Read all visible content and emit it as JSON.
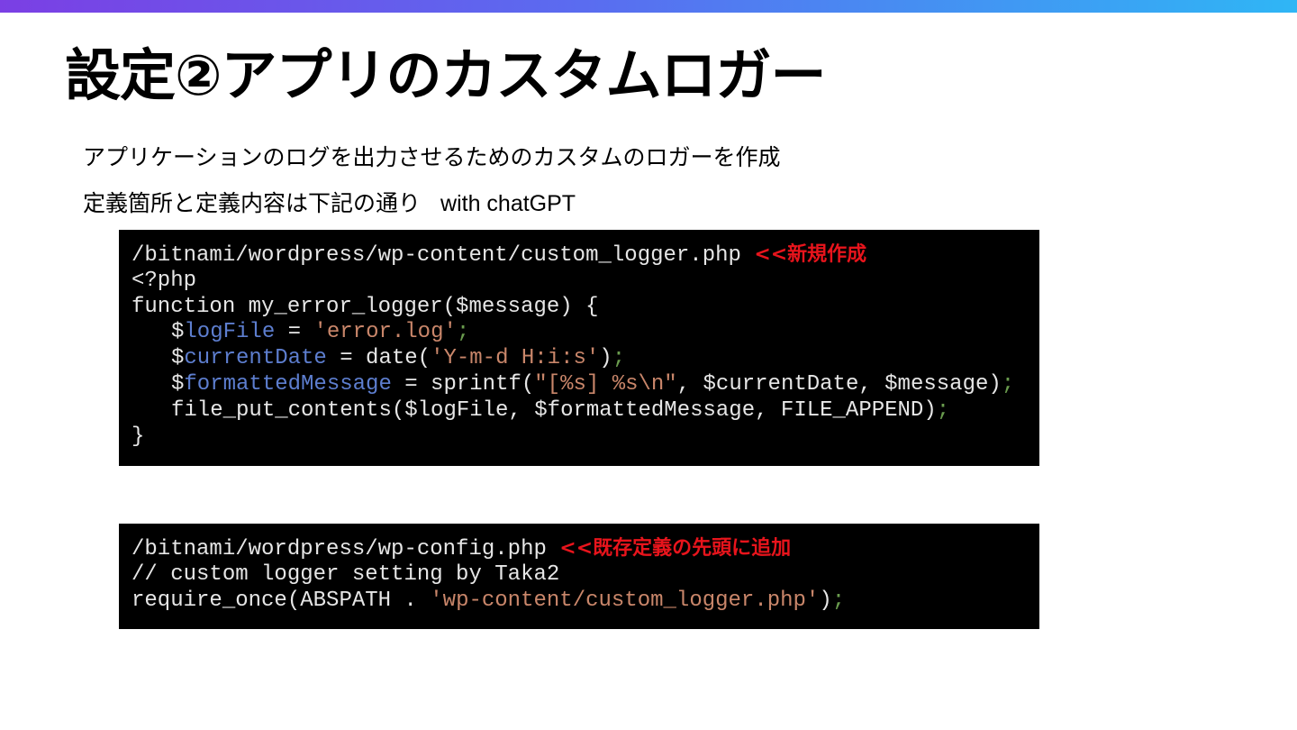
{
  "slide": {
    "title": "設定②アプリのカスタムロガー",
    "subtitle_1": "アプリケーションのログを出力させるためのカスタムのロガーを作成",
    "subtitle_2": "定義箇所と定義内容は下記の通り",
    "subtitle_2_suffix": "with chatGPT"
  },
  "code_block_1": {
    "path": "/bitnami/wordpress/wp-content/custom_logger.php ",
    "note": "<<新規作成",
    "line_2": "<?php",
    "line_3": "function my_error_logger($message) {",
    "line_4": {
      "a": "$",
      "b": "logFile",
      "c": " = ",
      "d": "'error.log'",
      "e": ";"
    },
    "line_5": {
      "a": "$",
      "b": "currentDate",
      "c": " = date(",
      "d": "'Y-m-d H:i:s'",
      "e": ")",
      "f": ";"
    },
    "line_6": {
      "a": "$",
      "b": "formattedMessage",
      "c": " = sprintf(",
      "d": "\"[%s] %s\\n\"",
      "e": ", $currentDate, $message)",
      "f": ";"
    },
    "line_7": {
      "a": "file_put_contents($logFile, $formattedMessage, FILE_APPEND)",
      "b": ";"
    },
    "line_8": "}"
  },
  "code_block_2": {
    "path": "/bitnami/wordpress/wp-config.php ",
    "note": "<<既存定義の先頭に追加",
    "line_2": "// custom logger setting by Taka2",
    "line_3": {
      "a": "require_once(ABSPATH . ",
      "b": "'wp-content/custom_logger.php'",
      "c": ")",
      "d": ";"
    }
  }
}
